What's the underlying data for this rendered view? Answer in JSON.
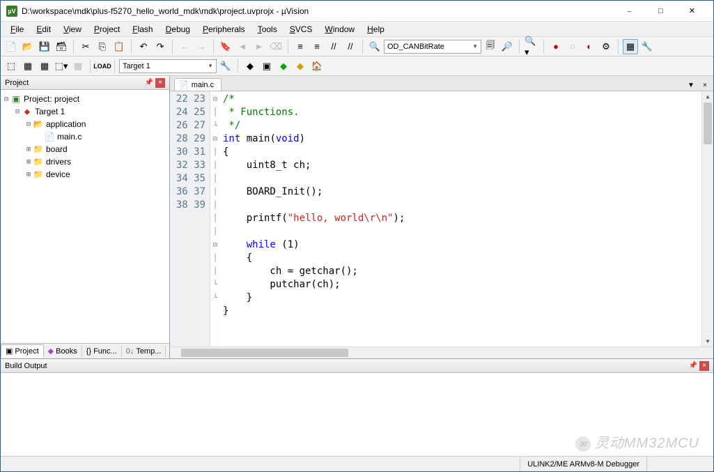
{
  "window": {
    "title": "D:\\workspace\\mdk\\plus-f5270_hello_world_mdk\\mdk\\project.uvprojx - µVision",
    "app_badge": "µV"
  },
  "menu": [
    "File",
    "Edit",
    "View",
    "Project",
    "Flash",
    "Debug",
    "Peripherals",
    "Tools",
    "SVCS",
    "Window",
    "Help"
  ],
  "toolbar": {
    "combo_label": "OD_CANBitRate"
  },
  "toolbar2": {
    "target_label": "Target 1"
  },
  "project_panel": {
    "title": "Project",
    "root": "Project: project",
    "target": "Target 1",
    "app_folder": "application",
    "app_file": "main.c",
    "folders": [
      "board",
      "drivers",
      "device"
    ],
    "tabs": [
      "Project",
      "Books",
      "Func...",
      "Temp..."
    ]
  },
  "editor": {
    "tab_label": "main.c",
    "lines": [
      {
        "n": 22,
        "fold": "⊟",
        "seg": [
          {
            "c": "cm",
            "t": "/*"
          }
        ]
      },
      {
        "n": 23,
        "fold": "│",
        "seg": [
          {
            "c": "cm",
            "t": " * Functions."
          }
        ]
      },
      {
        "n": 24,
        "fold": "└",
        "seg": [
          {
            "c": "cm",
            "t": " */"
          }
        ]
      },
      {
        "n": 25,
        "fold": "",
        "seg": [
          {
            "c": "kw",
            "t": "int"
          },
          {
            "c": "",
            "t": " main("
          },
          {
            "c": "kw",
            "t": "void"
          },
          {
            "c": "",
            "t": ")"
          }
        ]
      },
      {
        "n": 26,
        "fold": "⊟",
        "seg": [
          {
            "c": "",
            "t": "{"
          }
        ]
      },
      {
        "n": 27,
        "fold": "│",
        "seg": [
          {
            "c": "",
            "t": "    uint8_t ch;"
          }
        ]
      },
      {
        "n": 28,
        "fold": "│",
        "seg": [
          {
            "c": "",
            "t": ""
          }
        ]
      },
      {
        "n": 29,
        "fold": "│",
        "seg": [
          {
            "c": "",
            "t": "    BOARD_Init();"
          }
        ]
      },
      {
        "n": 30,
        "fold": "│",
        "seg": [
          {
            "c": "",
            "t": ""
          }
        ]
      },
      {
        "n": 31,
        "fold": "│",
        "seg": [
          {
            "c": "",
            "t": "    printf("
          },
          {
            "c": "str",
            "t": "\"hello, world\\r\\n\""
          },
          {
            "c": "",
            "t": ");"
          }
        ]
      },
      {
        "n": 32,
        "fold": "│",
        "seg": [
          {
            "c": "",
            "t": ""
          }
        ]
      },
      {
        "n": 33,
        "fold": "│",
        "seg": [
          {
            "c": "",
            "t": "    "
          },
          {
            "c": "kw",
            "t": "while"
          },
          {
            "c": "",
            "t": " ("
          },
          {
            "c": "num",
            "t": "1"
          },
          {
            "c": "",
            "t": ")"
          }
        ]
      },
      {
        "n": 34,
        "fold": "⊟",
        "seg": [
          {
            "c": "",
            "t": "    {"
          }
        ]
      },
      {
        "n": 35,
        "fold": "│",
        "seg": [
          {
            "c": "",
            "t": "        ch = getchar();"
          }
        ]
      },
      {
        "n": 36,
        "fold": "│",
        "seg": [
          {
            "c": "",
            "t": "        putchar(ch);"
          }
        ]
      },
      {
        "n": 37,
        "fold": "└",
        "seg": [
          {
            "c": "",
            "t": "    }"
          }
        ]
      },
      {
        "n": 38,
        "fold": "└",
        "seg": [
          {
            "c": "",
            "t": "}"
          }
        ]
      },
      {
        "n": 39,
        "fold": "",
        "seg": [
          {
            "c": "",
            "t": ""
          }
        ]
      }
    ]
  },
  "build": {
    "title": "Build Output"
  },
  "status": {
    "debugger": "ULINK2/ME ARMv8-M Debugger"
  },
  "watermark": "灵动MM32MCU"
}
